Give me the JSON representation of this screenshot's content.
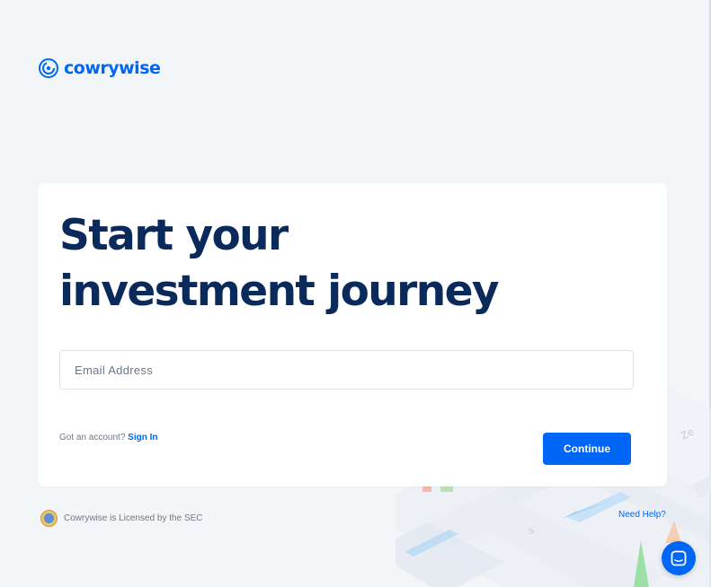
{
  "brand": {
    "name": "cowrywise",
    "color": "#0066f5",
    "logo_icon": "cowrywise-logo-icon"
  },
  "card": {
    "headline_line1": "Start your",
    "headline_line2": "investment journey",
    "email_placeholder": "Email Address",
    "email_value": "",
    "signin_prompt": "Got an account?",
    "signin_label": "Sign In",
    "continue_label": "Continue"
  },
  "footer": {
    "license_text": "Cowrywise is Licensed by the SEC",
    "license_icon": "sec-seal-icon",
    "need_help_label": "Need Help?",
    "chat_icon": "chat-bubble-icon"
  },
  "colors": {
    "background": "#f3f6f9",
    "headline": "#0b2a5c",
    "accent": "#0066f5",
    "muted": "#6c7786"
  }
}
